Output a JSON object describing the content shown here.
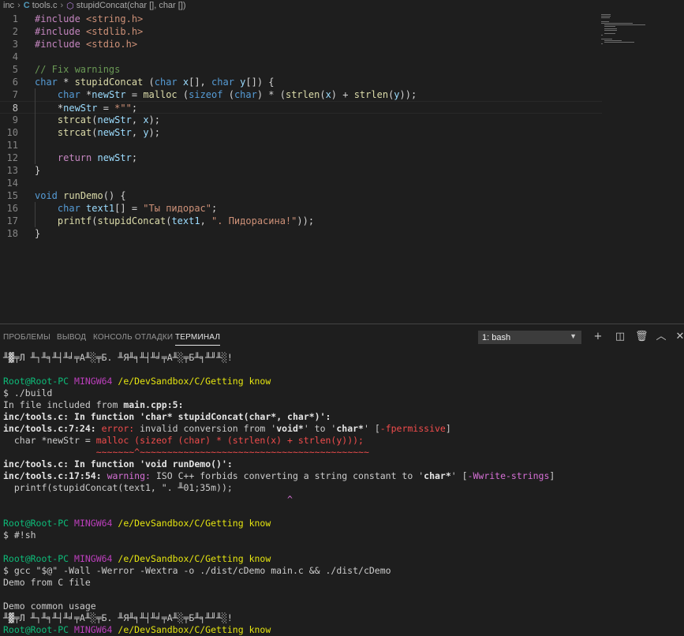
{
  "breadcrumb": {
    "folder": "inc",
    "file": "tools.c",
    "symbol": "stupidConcat(char [], char [])"
  },
  "editor": {
    "active_line": 8,
    "lines": [
      {
        "n": "1",
        "parts": [
          [
            "pp",
            "#include "
          ],
          [
            "inc",
            "<string.h>"
          ]
        ]
      },
      {
        "n": "2",
        "parts": [
          [
            "pp",
            "#include "
          ],
          [
            "inc",
            "<stdlib.h>"
          ]
        ]
      },
      {
        "n": "3",
        "parts": [
          [
            "pp",
            "#include "
          ],
          [
            "inc",
            "<stdio.h>"
          ]
        ]
      },
      {
        "n": "4",
        "parts": []
      },
      {
        "n": "5",
        "parts": [
          [
            "cm",
            "// Fix warnings"
          ]
        ]
      },
      {
        "n": "6",
        "parts": [
          [
            "kw",
            "char"
          ],
          [
            "op",
            " * "
          ],
          [
            "fn",
            "stupidConcat"
          ],
          [
            "op",
            " ("
          ],
          [
            "kw",
            "char"
          ],
          [
            "vr",
            " x"
          ],
          [
            "op",
            "[], "
          ],
          [
            "kw",
            "char"
          ],
          [
            "vr",
            " y"
          ],
          [
            "op",
            "[]) {"
          ]
        ]
      },
      {
        "n": "7",
        "parts": [
          [
            "op",
            "    "
          ],
          [
            "kw",
            "char"
          ],
          [
            "op",
            " *"
          ],
          [
            "vr",
            "newStr"
          ],
          [
            "op",
            " = "
          ],
          [
            "fn",
            "malloc"
          ],
          [
            "op",
            " ("
          ],
          [
            "kw",
            "sizeof"
          ],
          [
            "op",
            " ("
          ],
          [
            "kw",
            "char"
          ],
          [
            "op",
            ") * ("
          ],
          [
            "fn",
            "strlen"
          ],
          [
            "op",
            "("
          ],
          [
            "vr",
            "x"
          ],
          [
            "op",
            ") + "
          ],
          [
            "fn",
            "strlen"
          ],
          [
            "op",
            "("
          ],
          [
            "vr",
            "y"
          ],
          [
            "op",
            "));"
          ]
        ]
      },
      {
        "n": "8",
        "parts": [
          [
            "op",
            "    *"
          ],
          [
            "vr",
            "newStr"
          ],
          [
            "op",
            " = "
          ],
          [
            "str",
            "*\"\""
          ],
          [
            "op",
            ";"
          ]
        ]
      },
      {
        "n": "9",
        "parts": [
          [
            "op",
            "    "
          ],
          [
            "fn",
            "strcat"
          ],
          [
            "op",
            "("
          ],
          [
            "vr",
            "newStr"
          ],
          [
            "op",
            ", "
          ],
          [
            "vr",
            "x"
          ],
          [
            "op",
            ");"
          ]
        ]
      },
      {
        "n": "10",
        "parts": [
          [
            "op",
            "    "
          ],
          [
            "fn",
            "strcat"
          ],
          [
            "op",
            "("
          ],
          [
            "vr",
            "newStr"
          ],
          [
            "op",
            ", "
          ],
          [
            "vr",
            "y"
          ],
          [
            "op",
            ");"
          ]
        ]
      },
      {
        "n": "11",
        "parts": []
      },
      {
        "n": "12",
        "parts": [
          [
            "op",
            "    "
          ],
          [
            "pp",
            "return"
          ],
          [
            "vr",
            " newStr"
          ],
          [
            "op",
            ";"
          ]
        ]
      },
      {
        "n": "13",
        "parts": [
          [
            "op",
            "}"
          ]
        ]
      },
      {
        "n": "14",
        "parts": []
      },
      {
        "n": "15",
        "parts": [
          [
            "kw",
            "void"
          ],
          [
            "op",
            " "
          ],
          [
            "fn",
            "runDemo"
          ],
          [
            "op",
            "() {"
          ]
        ]
      },
      {
        "n": "16",
        "parts": [
          [
            "op",
            "    "
          ],
          [
            "kw",
            "char"
          ],
          [
            "vr",
            " text1"
          ],
          [
            "op",
            "[] = "
          ],
          [
            "str",
            "\"Ты пидорас\""
          ],
          [
            "op",
            ";"
          ]
        ]
      },
      {
        "n": "17",
        "parts": [
          [
            "op",
            "    "
          ],
          [
            "fn",
            "printf"
          ],
          [
            "op",
            "("
          ],
          [
            "fn",
            "stupidConcat"
          ],
          [
            "op",
            "("
          ],
          [
            "vr",
            "text1"
          ],
          [
            "op",
            ", "
          ],
          [
            "str",
            "\". Пидорасина!\""
          ],
          [
            "op",
            "));"
          ]
        ]
      },
      {
        "n": "18",
        "parts": [
          [
            "op",
            "}"
          ]
        ]
      }
    ]
  },
  "panel": {
    "tabs": [
      "ПРОБЛЕМЫ",
      "ВЫВОД",
      "КОНСОЛЬ ОТЛАДКИ",
      "ТЕРМИНАЛ"
    ],
    "active_tab": "ТЕРМИНАЛ",
    "terminal_selector": "1: bash",
    "icons": [
      "plus-icon",
      "split-icon",
      "trash-icon",
      "chevron-up-icon",
      "close-icon"
    ]
  },
  "terminal": {
    "lines": [
      [
        [
          "",
          "╨▓╤Л ╨┐╨╕╨┤╨╛╤А╨░╤Б. ╨Я╨╕╨┤╨╛╤А╨░╤Б╨╕╨╜╨░!"
        ]
      ],
      [],
      [
        [
          "green",
          "Root@Root-PC "
        ],
        [
          "mag",
          "MINGW64 "
        ],
        [
          "yel",
          "/e/DevSandbox/C/Getting know"
        ]
      ],
      [
        [
          "",
          "$ ./build"
        ]
      ],
      [
        [
          "",
          "In file included from "
        ],
        [
          "bold",
          "main.cpp:5:"
        ]
      ],
      [
        [
          "bold",
          "inc/tools.c:"
        ],
        [
          "bold",
          " In function '"
        ],
        [
          "bold",
          "char* stupidConcat(char*, char*)"
        ],
        [
          "bold",
          "':"
        ]
      ],
      [
        [
          "bold",
          "inc/tools.c:7:24: "
        ],
        [
          "red",
          "error: "
        ],
        [
          "",
          "invalid conversion from '"
        ],
        [
          "bold",
          "void*"
        ],
        [
          "",
          "' to '"
        ],
        [
          "bold",
          "char*"
        ],
        [
          "",
          "' ["
        ],
        [
          "red",
          "-fpermissive"
        ],
        [
          "",
          "]"
        ]
      ],
      [
        [
          "",
          "  char *newStr = "
        ],
        [
          "red",
          "malloc (sizeof (char) * (strlen(x) + strlen(y)));"
        ]
      ],
      [
        [
          "",
          "                 "
        ],
        [
          "red",
          "~~~~~~~^~~~~~~~~~~~~~~~~~~~~~~~~~~~~~~~~~~~~~~~~~~"
        ]
      ],
      [
        [
          "bold",
          "inc/tools.c:"
        ],
        [
          "bold",
          " In function '"
        ],
        [
          "bold",
          "void runDemo()"
        ],
        [
          "bold",
          "':"
        ]
      ],
      [
        [
          "bold",
          "inc/tools.c:17:54: "
        ],
        [
          "wmag",
          "warning: "
        ],
        [
          "",
          "ISO C++ forbids converting a string constant to '"
        ],
        [
          "bold",
          "char*"
        ],
        [
          "",
          "' ["
        ],
        [
          "wmag",
          "-Wwrite-strings"
        ],
        [
          "",
          "]"
        ]
      ],
      [
        [
          "",
          "  printf(stupidConcat(text1, \". ╨01;35m));"
        ]
      ],
      [
        [
          "",
          "                                                    "
        ],
        [
          "wmag",
          "^"
        ]
      ],
      [],
      [
        [
          "green",
          "Root@Root-PC "
        ],
        [
          "mag",
          "MINGW64 "
        ],
        [
          "yel",
          "/e/DevSandbox/C/Getting know"
        ]
      ],
      [
        [
          "",
          "$ #!sh"
        ]
      ],
      [],
      [
        [
          "green",
          "Root@Root-PC "
        ],
        [
          "mag",
          "MINGW64 "
        ],
        [
          "yel",
          "/e/DevSandbox/C/Getting know"
        ]
      ],
      [
        [
          "",
          "$ gcc \"$@\" -Wall -Werror -Wextra -o ./dist/cDemo main.c && ./dist/cDemo"
        ]
      ],
      [
        [
          "",
          "Demo from C file"
        ]
      ],
      [],
      [
        [
          "",
          "Demo common usage"
        ]
      ],
      [
        [
          "",
          "╨▓╤Л ╨┐╨╕╨┤╨╛╤А╨░╤Б. ╨Я╨╕╨┤╨╛╤А╨░╤Б╨╕╨╜╨░!"
        ]
      ],
      [
        [
          "green",
          "Root@Root-PC "
        ],
        [
          "mag",
          "MINGW64 "
        ],
        [
          "yel",
          "/e/DevSandbox/C/Getting know"
        ]
      ]
    ]
  }
}
